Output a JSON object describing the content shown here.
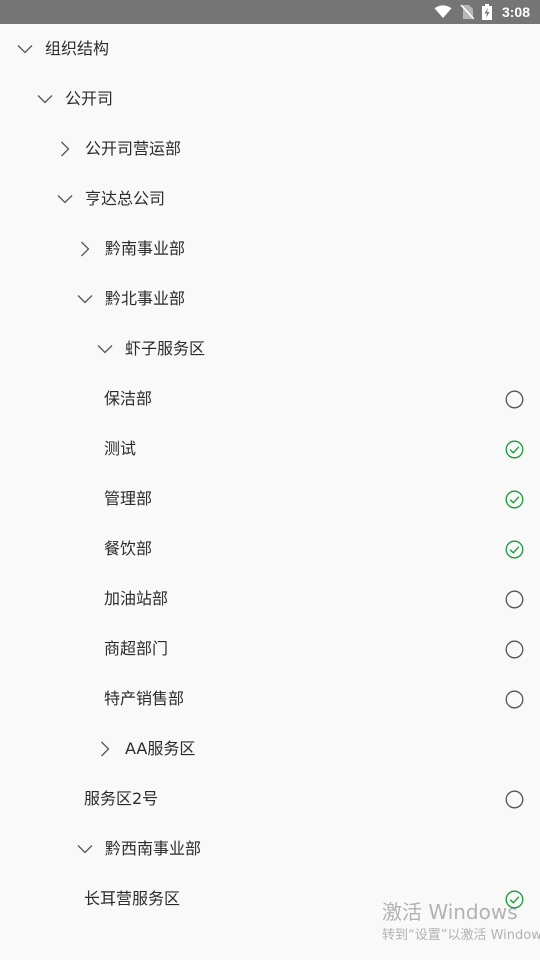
{
  "status_bar": {
    "time": "3:08",
    "icons": [
      "wifi-icon",
      "no-sim-icon",
      "battery-charging-icon"
    ]
  },
  "colors": {
    "status_bar_bg": "#757575",
    "background": "#f9f9f9",
    "text": "#2b2b2b",
    "chevron": "#555555",
    "radio_unchecked": "#555555",
    "radio_checked": "#1a9a3a"
  },
  "tree": {
    "nodes": [
      {
        "label": "组织结构",
        "level": 0,
        "expander": "expanded"
      },
      {
        "label": "公开司",
        "level": 1,
        "expander": "expanded"
      },
      {
        "label": "公开司营运部",
        "level": 2,
        "expander": "collapsed"
      },
      {
        "label": "亨达总公司",
        "level": 2,
        "expander": "expanded"
      },
      {
        "label": "黔南事业部",
        "level": 3,
        "expander": "collapsed"
      },
      {
        "label": "黔北事业部",
        "level": 3,
        "expander": "expanded"
      },
      {
        "label": "虾子服务区",
        "level": 4,
        "expander": "expanded"
      },
      {
        "label": "保洁部",
        "level": 5,
        "expander": "none",
        "radio": "unchecked"
      },
      {
        "label": "测试",
        "level": 5,
        "expander": "none",
        "radio": "checked"
      },
      {
        "label": "管理部",
        "level": 5,
        "expander": "none",
        "radio": "checked"
      },
      {
        "label": "餐饮部",
        "level": 5,
        "expander": "none",
        "radio": "checked"
      },
      {
        "label": "加油站部",
        "level": 5,
        "expander": "none",
        "radio": "unchecked"
      },
      {
        "label": "商超部门",
        "level": 5,
        "expander": "none",
        "radio": "unchecked"
      },
      {
        "label": "特产销售部",
        "level": 5,
        "expander": "none",
        "radio": "unchecked"
      },
      {
        "label": "AA服务区",
        "level": 4,
        "expander": "collapsed"
      },
      {
        "label": "服务区2号",
        "level": 4,
        "expander": "none",
        "radio": "unchecked"
      },
      {
        "label": "黔西南事业部",
        "level": 3,
        "expander": "expanded"
      },
      {
        "label": "长耳营服务区",
        "level": 4,
        "expander": "none",
        "radio": "checked"
      }
    ]
  },
  "watermark": {
    "title": "激活 Windows",
    "subtitle": "转到“设置”以激活 Windows。"
  }
}
